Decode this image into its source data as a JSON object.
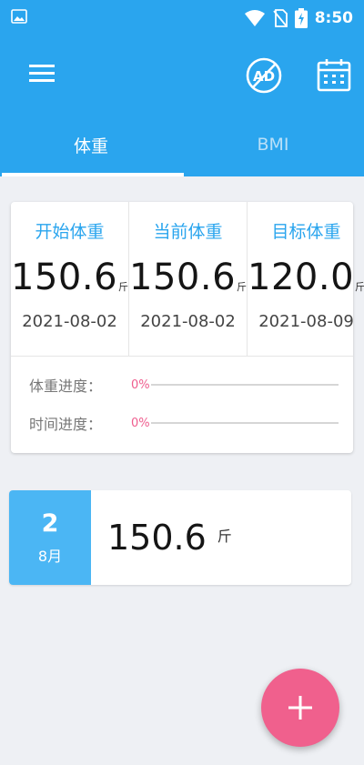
{
  "status_bar": {
    "time": "8:50"
  },
  "toolbar": {
    "menu_icon": "menu-icon",
    "ad_icon": "no-ads-icon",
    "ad_text": "AD",
    "calendar_icon": "calendar-icon"
  },
  "tabs": [
    {
      "label": "体重",
      "active": true
    },
    {
      "label": "BMI",
      "active": false
    }
  ],
  "summary": {
    "columns": [
      {
        "label": "开始体重",
        "value": "150.6",
        "unit": "斤",
        "date": "2021-08-02"
      },
      {
        "label": "当前体重",
        "value": "150.6",
        "unit": "斤",
        "date": "2021-08-02"
      },
      {
        "label": "目标体重",
        "value": "120.0",
        "unit": "斤",
        "date": "2021-08-09"
      }
    ],
    "progress": [
      {
        "label": "体重进度：",
        "percent_text": "0%",
        "percent": 0
      },
      {
        "label": "时间进度：",
        "percent_text": "0%",
        "percent": 0
      }
    ]
  },
  "records": [
    {
      "day": "2",
      "month": "8月",
      "weight": "150.6",
      "unit": "斤"
    }
  ],
  "fab": {
    "icon": "plus-icon"
  },
  "colors": {
    "primary": "#2aa5ee",
    "accent": "#f0608d",
    "record_date_bg": "#4bb6f4",
    "progress_text": "#ef5d8e"
  }
}
